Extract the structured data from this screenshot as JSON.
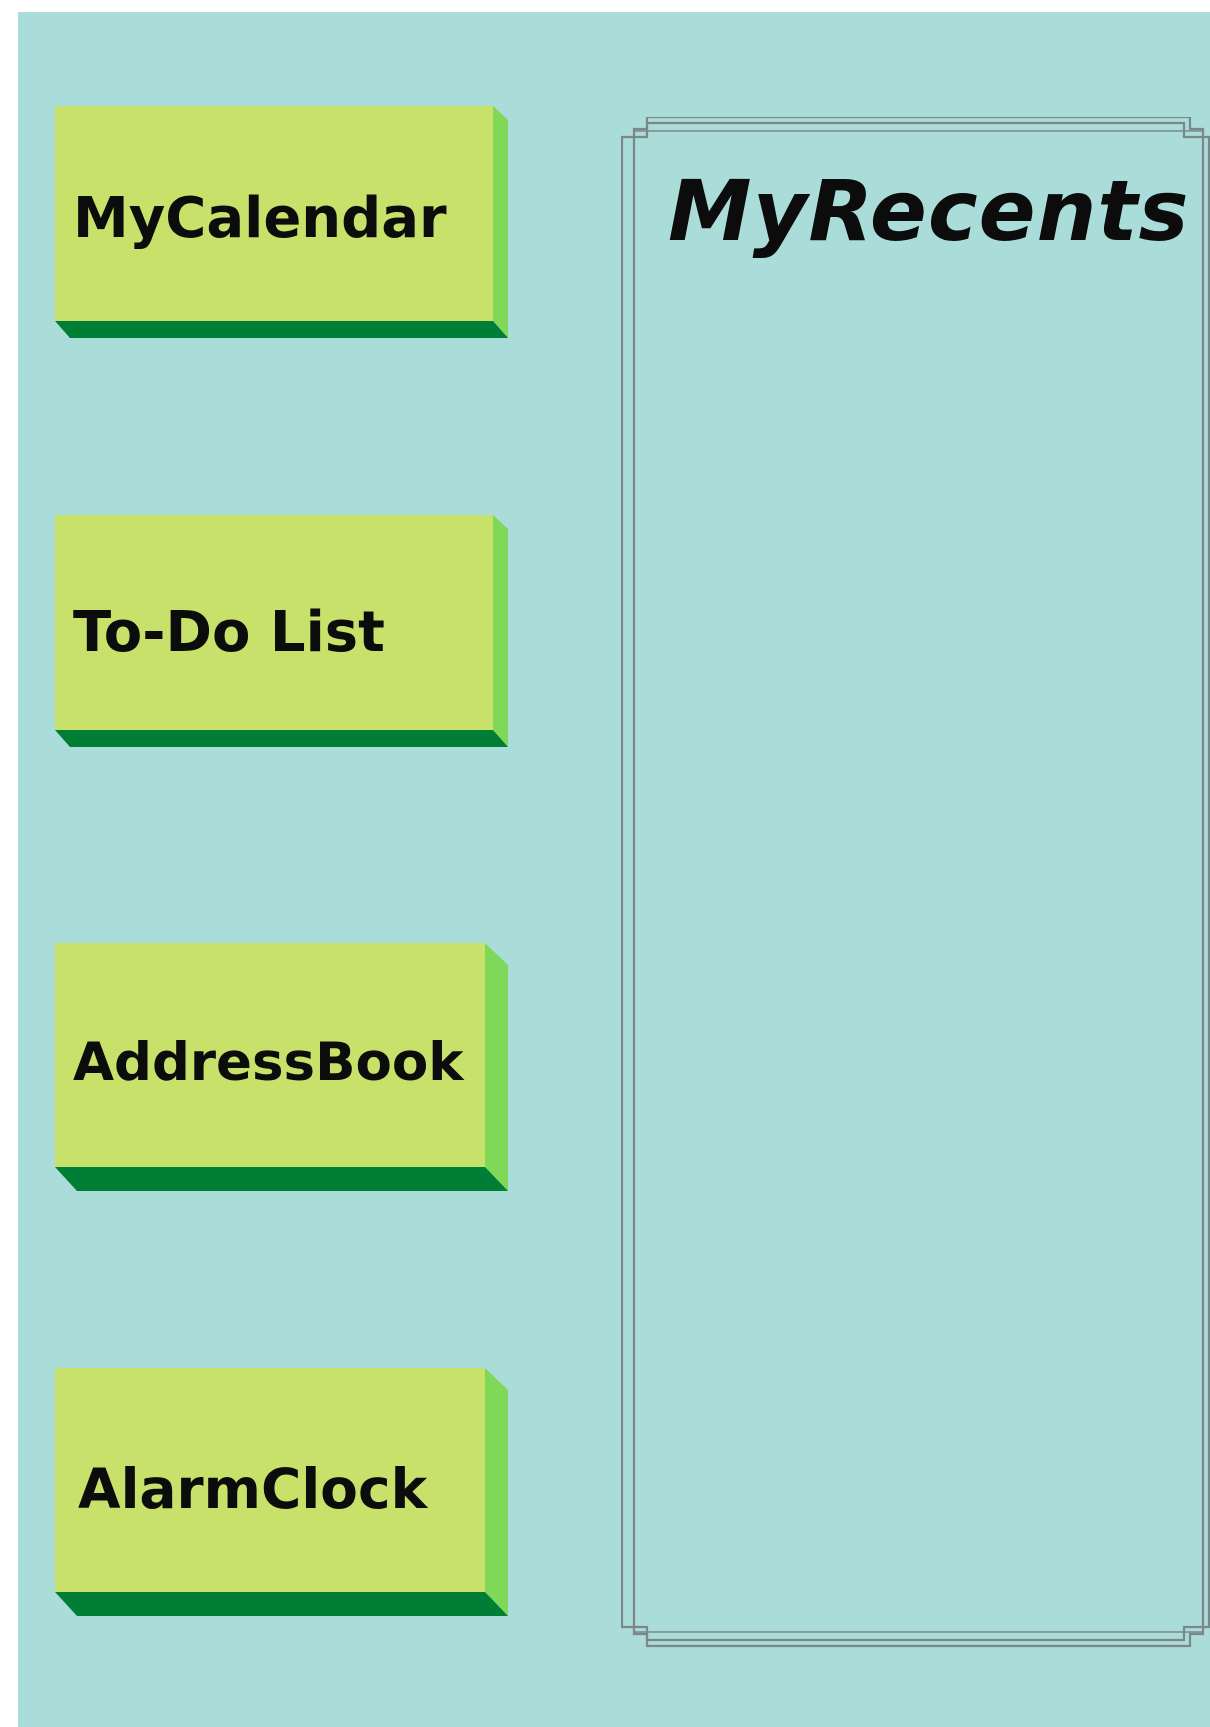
{
  "colors": {
    "background": "#aaddd9",
    "button_face": "#c8e16a",
    "button_side": "#7fd857",
    "button_bottom": "#007e36",
    "frame_line": "#7c878a",
    "text": "#0c0c0c"
  },
  "launcher": {
    "buttons": [
      {
        "label": "MyCalendar"
      },
      {
        "label": "To-Do List"
      },
      {
        "label": "AddressBook"
      },
      {
        "label": "AlarmClock"
      }
    ]
  },
  "recents": {
    "title": "MyRecents",
    "items": []
  }
}
